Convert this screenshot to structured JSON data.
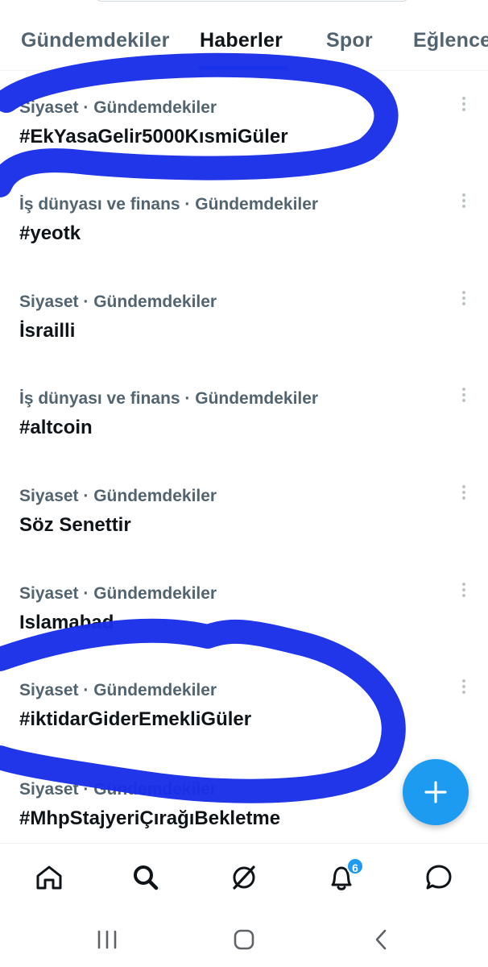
{
  "tabs": [
    {
      "label": "Gündemdekiler",
      "active": false
    },
    {
      "label": "Haberler",
      "active": true
    },
    {
      "label": "Spor",
      "active": false
    },
    {
      "label": "Eğlence",
      "active": false
    }
  ],
  "trends": [
    {
      "meta": "Siyaset · Gündemdekiler",
      "title": "#EkYasaGelir5000KısmiGüler"
    },
    {
      "meta": "İş dünyası ve finans · Gündemdekiler",
      "title": "#yeotk"
    },
    {
      "meta": "Siyaset · Gündemdekiler",
      "title": "İsrailli"
    },
    {
      "meta": "İş dünyası ve finans · Gündemdekiler",
      "title": "#altcoin"
    },
    {
      "meta": "Siyaset · Gündemdekiler",
      "title": "Söz Senettir"
    },
    {
      "meta": "Siyaset · Gündemdekiler",
      "title": "Islamabad"
    },
    {
      "meta": "Siyaset · Gündemdekiler",
      "title": "#iktidarGiderEmekliGüler"
    },
    {
      "meta": "Siyaset · Gündemdekiler",
      "title": "#MhpStajyeriÇırağıBekletme"
    }
  ],
  "fab": {
    "icon": "plus-icon"
  },
  "bottom_nav": {
    "items": [
      "home-icon",
      "search-icon",
      "grok-icon",
      "bell-icon",
      "messages-icon"
    ],
    "notification_count": "6"
  },
  "system_nav": [
    "recent-apps-icon",
    "home-circle-icon",
    "back-icon"
  ],
  "colors": {
    "accent": "#1d9bf0",
    "scribble": "#1a2ee8",
    "muted": "#536471"
  }
}
